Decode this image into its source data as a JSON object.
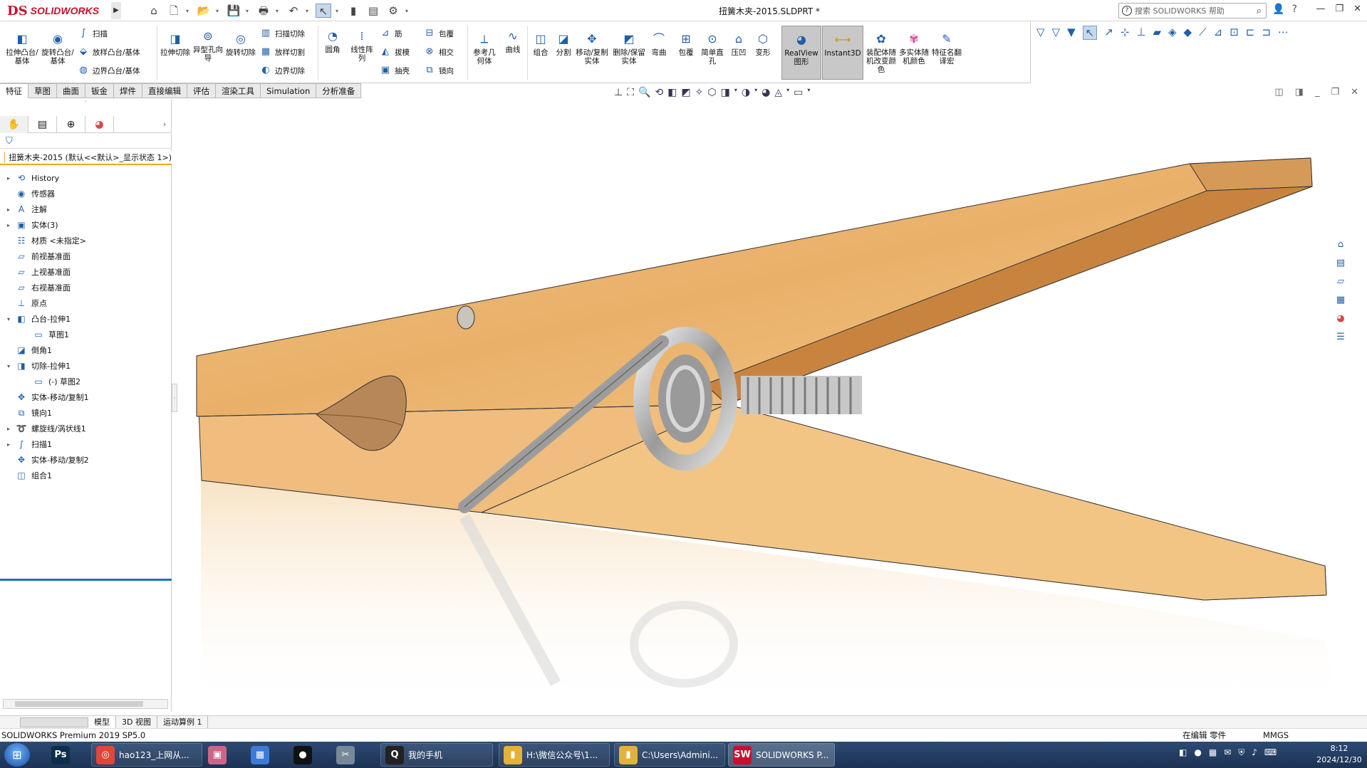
{
  "app": {
    "brand": "SOLIDWORKS",
    "brand_mark": "DS",
    "brand_color": "#c8102e"
  },
  "title": {
    "document": "扭簧木夹-2015.SLDPRT *"
  },
  "help_search": {
    "placeholder": "搜索 SOLIDWORKS 帮助"
  },
  "ribbon": {
    "extrude_boss": "拉伸凸台/基体",
    "revolve_boss": "旋转凸台/基体",
    "sweep": "扫描",
    "loft_boss": "放样凸台/基体",
    "boundary_boss": "边界凸台/基体",
    "extrude_cut": "拉伸切除",
    "hole_wizard": "异型孔向导",
    "revolve_cut": "旋转切除",
    "swept_cut": "扫描切除",
    "lofted_cut": "放样切割",
    "boundary_cut": "边界切除",
    "fillet": "圆角",
    "linear_pattern": "线性阵列",
    "rib": "筋",
    "draft": "拔模",
    "shell": "抽壳",
    "wrap": "包覆",
    "intersect": "相交",
    "mirror": "镜向",
    "ref_geometry": "参考几何体",
    "curves": "曲线",
    "combine": "组合",
    "split": "分割",
    "move_copy": "移动/复制实体",
    "delete_keep": "删除/保留实体",
    "flex": "弯曲",
    "wrap2": "包覆",
    "simple_hole": "简单直孔",
    "indent": "压凹",
    "deform": "变形",
    "realview": "RealView图形",
    "instant3d": "Instant3D",
    "assembly_color": "装配体随机改变颜色",
    "multibody_color": "多实体随机颜色",
    "feature_rename": "特征名翻译宏"
  },
  "cmd_tabs": [
    "特征",
    "草图",
    "曲面",
    "钣金",
    "焊件",
    "直接编辑",
    "评估",
    "渲染工具",
    "Simulation",
    "分析准备"
  ],
  "feature_manager": {
    "root": "扭簧木夹-2015 (默认<<默认>_显示状态 1>)",
    "items": [
      {
        "label": "History",
        "icon": "history-icon",
        "expand": "▸",
        "indent": 0
      },
      {
        "label": "传感器",
        "icon": "sensor-icon",
        "expand": "",
        "indent": 0
      },
      {
        "label": "注解",
        "icon": "annotation-icon",
        "expand": "▸",
        "indent": 0
      },
      {
        "label": "实体(3)",
        "icon": "solid-bodies-icon",
        "expand": "▸",
        "indent": 0
      },
      {
        "label": "材质 <未指定>",
        "icon": "material-icon",
        "expand": "",
        "indent": 0
      },
      {
        "label": "前视基准面",
        "icon": "plane-icon",
        "expand": "",
        "indent": 0
      },
      {
        "label": "上视基准面",
        "icon": "plane-icon",
        "expand": "",
        "indent": 0
      },
      {
        "label": "右视基准面",
        "icon": "plane-icon",
        "expand": "",
        "indent": 0
      },
      {
        "label": "原点",
        "icon": "origin-icon",
        "expand": "",
        "indent": 0
      },
      {
        "label": "凸台-拉伸1",
        "icon": "boss-extrude-icon",
        "expand": "▾",
        "indent": 0
      },
      {
        "label": "草图1",
        "icon": "sketch-icon",
        "expand": "",
        "indent": 1
      },
      {
        "label": "倒角1",
        "icon": "chamfer-icon",
        "expand": "",
        "indent": 0
      },
      {
        "label": "切除-拉伸1",
        "icon": "cut-extrude-icon",
        "expand": "▾",
        "indent": 0
      },
      {
        "label": "(-) 草图2",
        "icon": "sketch-icon",
        "expand": "",
        "indent": 1
      },
      {
        "label": "实体-移动/复制1",
        "icon": "move-copy-icon",
        "expand": "",
        "indent": 0
      },
      {
        "label": "镜向1",
        "icon": "mirror-icon",
        "expand": "",
        "indent": 0
      },
      {
        "label": "螺旋线/涡状线1",
        "icon": "helix-icon",
        "expand": "▸",
        "indent": 0
      },
      {
        "label": "扫描1",
        "icon": "sweep-icon",
        "expand": "▸",
        "indent": 0
      },
      {
        "label": "实体-移动/复制2",
        "icon": "move-copy-icon",
        "expand": "",
        "indent": 0
      },
      {
        "label": "组合1",
        "icon": "combine-icon",
        "expand": "",
        "indent": 0
      }
    ]
  },
  "model_tabs": [
    "模型",
    "3D 视图",
    "运动算例 1"
  ],
  "status": {
    "version": "SOLIDWORKS Premium 2019 SP5.0",
    "mode": "在编辑 零件",
    "units": "MMGS"
  },
  "taskbar": {
    "items": [
      {
        "label": "",
        "icon": "photoshop-icon",
        "glyph": "Ps",
        "color": "#0d2e4a"
      },
      {
        "label": "hao123_上网从...",
        "icon": "browser-icon",
        "glyph": "◎",
        "color": "#e0463a"
      },
      {
        "label": "",
        "icon": "app-icon",
        "glyph": "▣",
        "color": "#cc6688"
      },
      {
        "label": "",
        "icon": "tiles-icon",
        "glyph": "▦",
        "color": "#3b7ad9"
      },
      {
        "label": "",
        "icon": "record-icon",
        "glyph": "●",
        "color": "#111111"
      },
      {
        "label": "",
        "icon": "tool-icon",
        "glyph": "✂",
        "color": "#778899"
      },
      {
        "label": "我的手机",
        "icon": "qq-icon",
        "glyph": "Q",
        "color": "#222222"
      },
      {
        "label": "H:\\微信公众号\\1...",
        "icon": "folder-icon",
        "glyph": "▮",
        "color": "#e2b23a"
      },
      {
        "label": "C:\\Users\\Admini...",
        "icon": "folder-icon",
        "glyph": "▮",
        "color": "#e2b23a"
      },
      {
        "label": "SOLIDWORKS P...",
        "icon": "solidworks-icon",
        "glyph": "SW",
        "color": "#c8102e"
      }
    ],
    "time": "8:12",
    "date": "2024/12/30"
  }
}
